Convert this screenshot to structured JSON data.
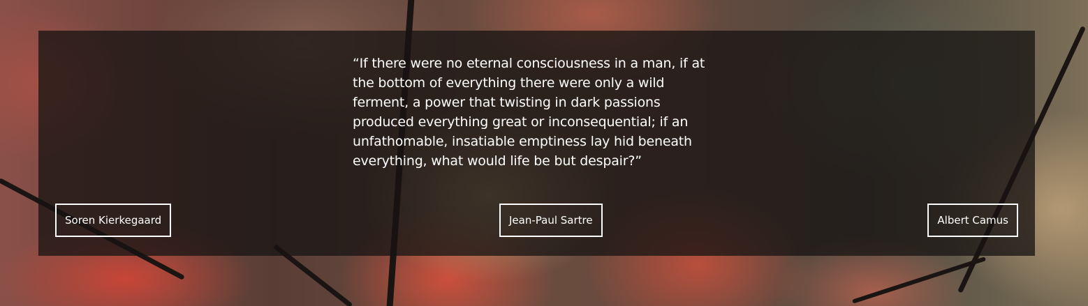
{
  "quote": {
    "text": "“If there were no eternal consciousness in a man, if at the bottom of everything there were only a wild ferment, a power that twisting in dark passions produced everything great or inconsequential; if an unfathomable, insatiable emptiness lay hid beneath everything, what would life be but despair?”"
  },
  "authors": {
    "left": "Soren Kierkegaard",
    "center": "Jean-Paul Sartre",
    "right": "Albert Camus"
  },
  "colors": {
    "overlay": "#181412",
    "text": "#ffffff",
    "button_border": "#ffffff"
  }
}
